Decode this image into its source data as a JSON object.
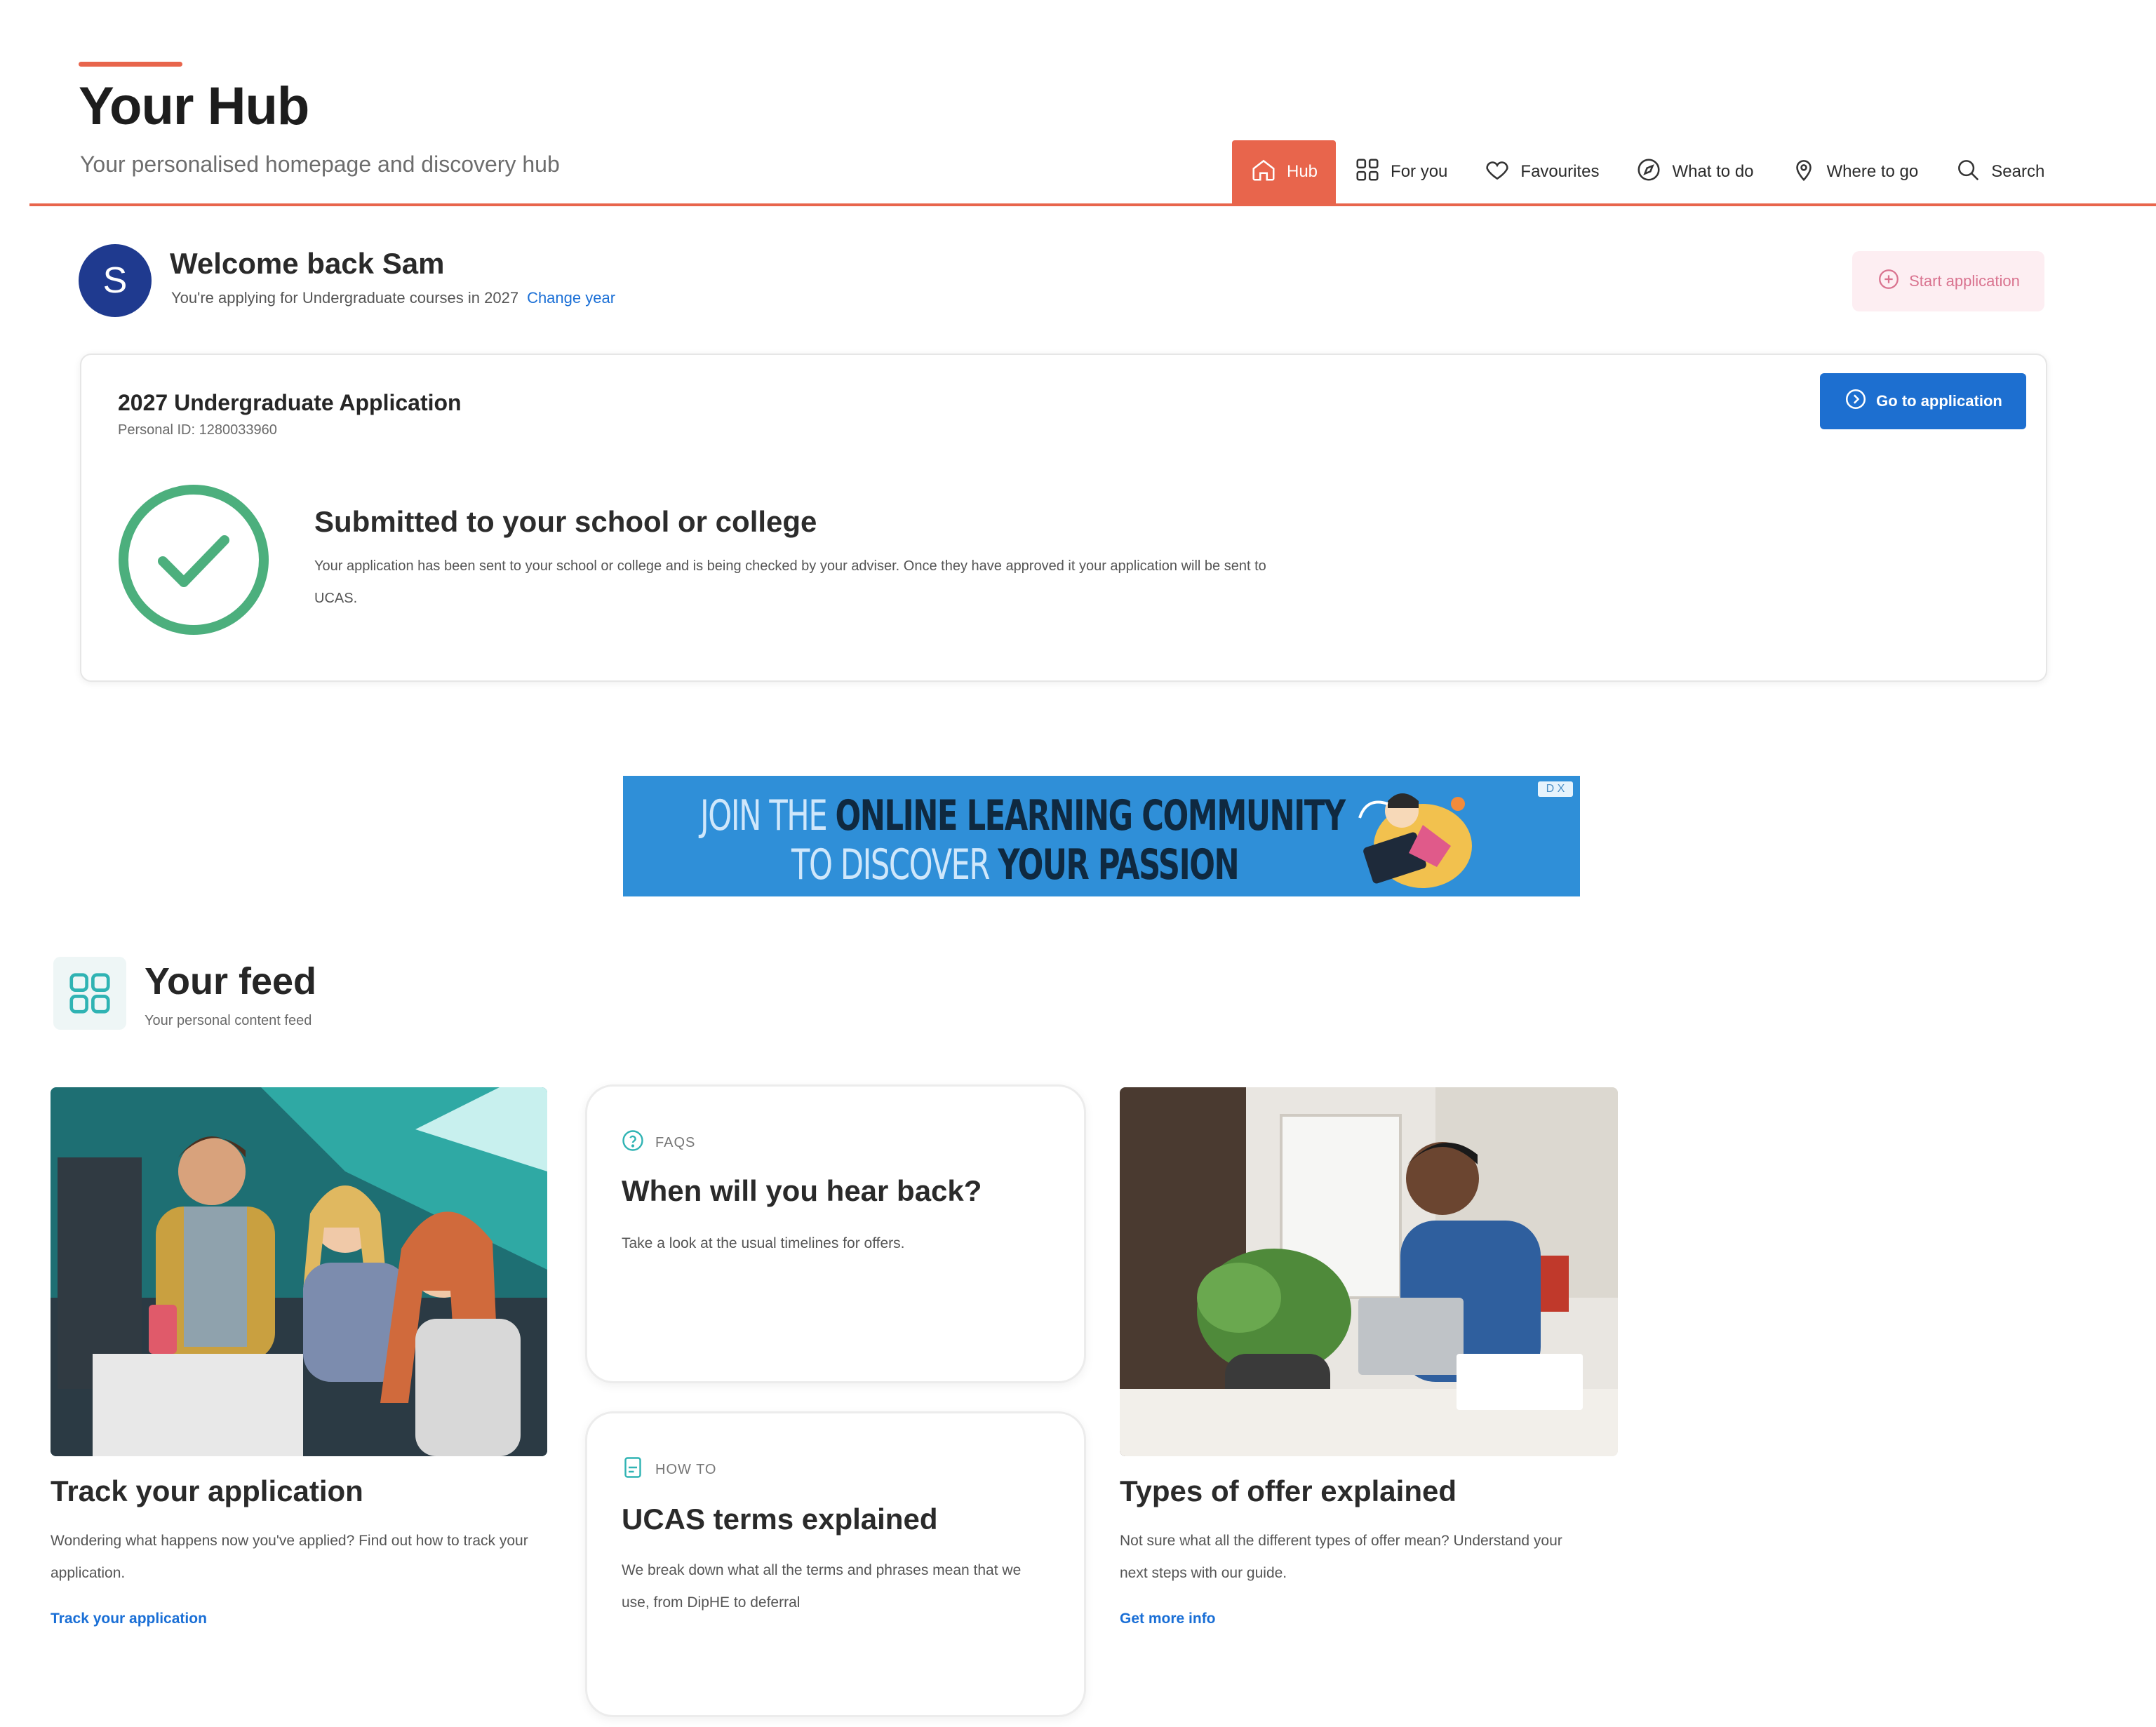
{
  "header": {
    "title": "Your Hub",
    "subtitle": "Your personalised homepage and discovery hub"
  },
  "nav": {
    "items": [
      {
        "label": "Hub",
        "icon": "home-icon",
        "active": true
      },
      {
        "label": "For you",
        "icon": "grid-icon"
      },
      {
        "label": "Favourites",
        "icon": "heart-icon"
      },
      {
        "label": "What to do",
        "icon": "compass-icon"
      },
      {
        "label": "Where to go",
        "icon": "location-pin-icon"
      },
      {
        "label": "Search",
        "icon": "search-icon"
      }
    ]
  },
  "welcome": {
    "avatar_letter": "S",
    "title": "Welcome back Sam",
    "subtitle": "You're applying for Undergraduate courses in 2027",
    "change_year": "Change year",
    "start_application": "Start application"
  },
  "application": {
    "title": "2027 Undergraduate Application",
    "personal_id": "Personal ID: 1280033960",
    "go_button": "Go to application",
    "status_title": "Submitted to your school or college",
    "status_body": "Your application has been sent to your school or college and is being checked by your adviser. Once they have approved it your application will be sent to UCAS."
  },
  "ad": {
    "line1_light": "JOIN THE ",
    "line1_dark": "ONLINE LEARNING COMMUNITY",
    "line2_light": "TO DISCOVER ",
    "line2_dark": "YOUR PASSION",
    "close": "D X"
  },
  "feed": {
    "title": "Your feed",
    "subtitle": "Your personal content feed",
    "cards": [
      {
        "title": "Track your application",
        "body": "Wondering what happens now you've applied? Find out how to track your application.",
        "link": "Track your application"
      },
      {
        "tag": "FAQS",
        "title": "When will you hear back?",
        "body": "Take a look at the usual timelines for offers."
      },
      {
        "tag": "HOW TO",
        "title": "UCAS terms explained",
        "body": "We break down what all the terms and phrases mean that we use, from DipHE to deferral"
      },
      {
        "title": "Types of offer explained",
        "body": "Not sure what all the different types of offer mean? Understand your next steps with our guide.",
        "link": "Get more info"
      }
    ]
  },
  "colors": {
    "accent": "#e8654c",
    "primary_blue": "#1d6fd0",
    "success_green": "#4caf7d",
    "avatar_navy": "#1f3a8f"
  }
}
